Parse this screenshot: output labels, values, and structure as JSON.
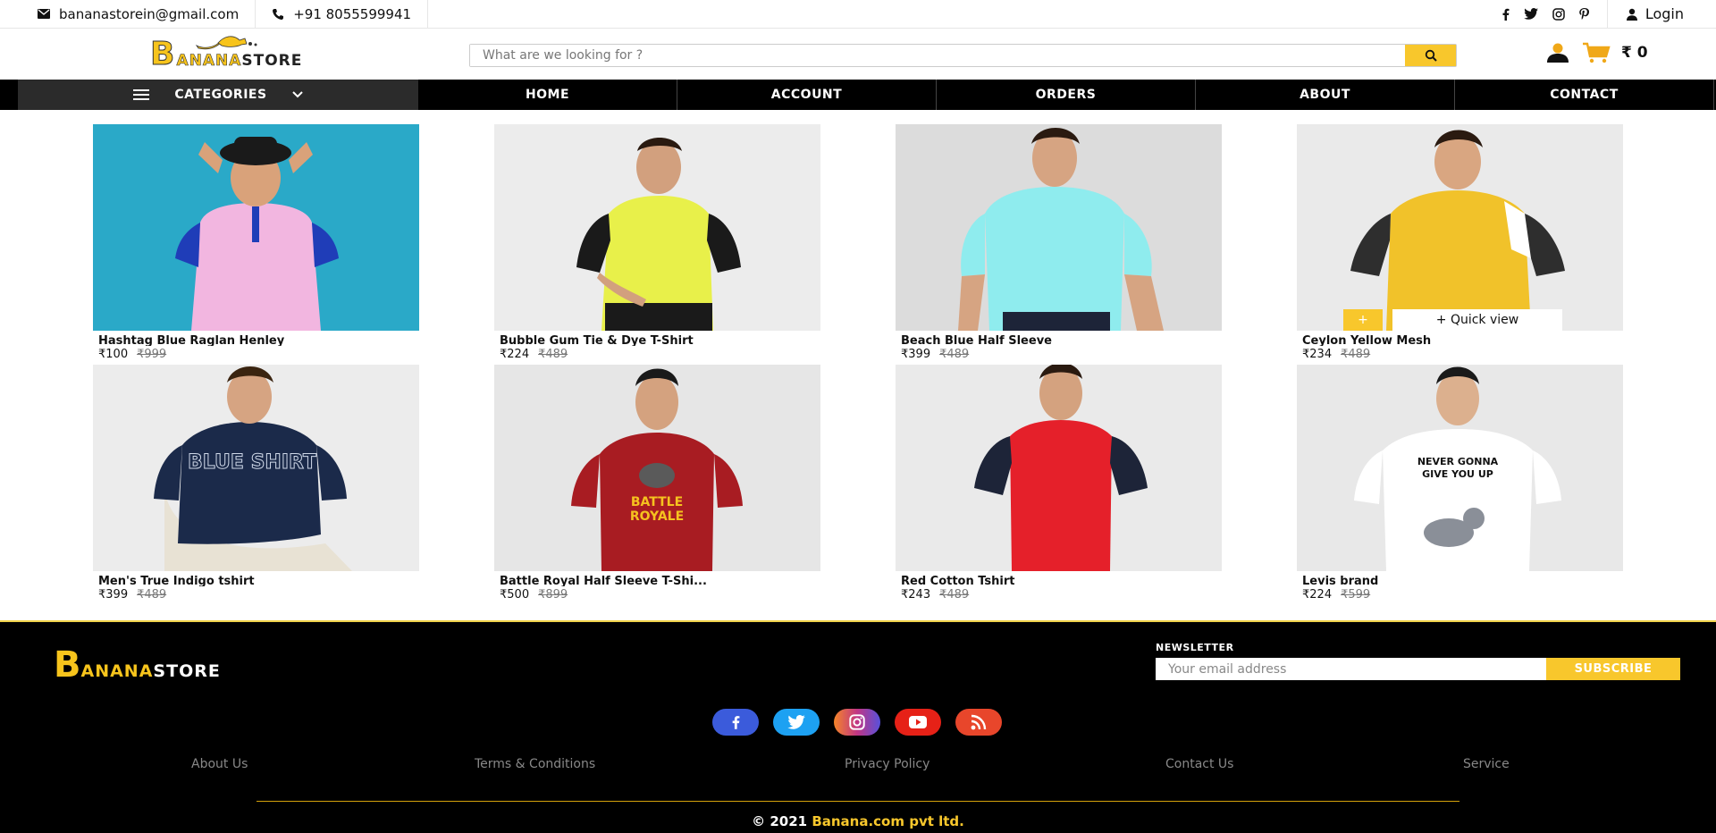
{
  "topbar": {
    "email": "bananastorein@gmail.com",
    "phone": "+91 8055599941",
    "login": "Login",
    "social_icons": [
      "facebook-icon",
      "twitter-icon",
      "instagram-icon",
      "pinterest-icon"
    ]
  },
  "header": {
    "logo_letter": "B",
    "logo_yellow": "ANANA",
    "logo_dark": "STORE",
    "search_placeholder": "What are we looking for ?",
    "cart_total": "₹ 0"
  },
  "nav": {
    "categories": "CATEGORIES",
    "items": [
      "HOME",
      "ACCOUNT",
      "ORDERS",
      "ABOUT",
      "CONTACT"
    ]
  },
  "products": [
    {
      "name": "Hashtag Blue Raglan Henley",
      "price": "₹100",
      "old_price": "₹999"
    },
    {
      "name": "Bubble Gum Tie & Dye T-Shirt",
      "price": "₹224",
      "old_price": "₹489"
    },
    {
      "name": "Beach Blue Half Sleeve",
      "price": "₹399",
      "old_price": "₹489"
    },
    {
      "name": "Ceylon Yellow Mesh",
      "price": "₹234",
      "old_price": "₹489"
    },
    {
      "name": "Men's True Indigo tshirt",
      "price": "₹399",
      "old_price": "₹489"
    },
    {
      "name": "Battle Royal Half Sleeve T-Shi...",
      "price": "₹500",
      "old_price": "₹899"
    },
    {
      "name": "Red Cotton Tshirt",
      "price": "₹243",
      "old_price": "₹489"
    },
    {
      "name": "Levis brand",
      "price": "₹224",
      "old_price": "₹599"
    }
  ],
  "quick_view": "+ Quick view",
  "quick_view_plus": "+",
  "tshirt_prints": {
    "blue_shirt": "BLUE SHIRT",
    "battle": "BATTLE",
    "royale": "ROYALE",
    "never_gonna": "NEVER GONNA",
    "give_you_up": "GIVE YOU UP"
  },
  "footer": {
    "logo_letter": "B",
    "logo_yellow": "ANANA",
    "logo_white": "STORE",
    "newsletter_label": "NEWSLETTER",
    "newsletter_placeholder": "Your email address",
    "subscribe": "SUBSCRIBE",
    "links": [
      "About Us",
      "Terms & Conditions",
      "Privacy Policy",
      "Contact Us",
      "Service"
    ],
    "copyright_prefix": "© 2021 ",
    "copyright_brand": "Banana.com pvt ltd.",
    "social": [
      {
        "icon": "facebook-icon",
        "color": "#3b5bdb"
      },
      {
        "icon": "twitter-icon",
        "color": "#1da1f2"
      },
      {
        "icon": "instagram-icon",
        "color": "#c13584"
      },
      {
        "icon": "youtube-icon",
        "color": "#e62117"
      },
      {
        "icon": "rss-icon",
        "color": "#e8462b"
      }
    ]
  },
  "colors": {
    "accent": "#f8c72c",
    "nav_bg": "#000000",
    "footer_bg": "#000000"
  }
}
